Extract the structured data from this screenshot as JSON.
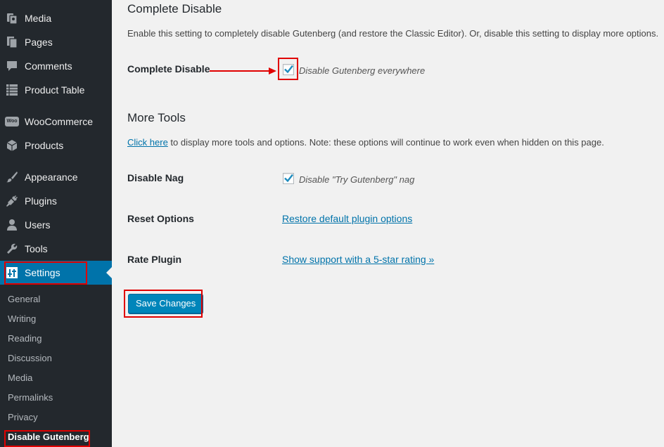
{
  "sidebar": {
    "items": [
      {
        "label": "Media",
        "icon": "media-icon"
      },
      {
        "label": "Pages",
        "icon": "pages-icon"
      },
      {
        "label": "Comments",
        "icon": "comments-icon"
      },
      {
        "label": "Product Table",
        "icon": "table-icon"
      },
      {
        "label": "WooCommerce",
        "icon": "woocommerce-icon"
      },
      {
        "label": "Products",
        "icon": "products-box-icon"
      },
      {
        "label": "Appearance",
        "icon": "appearance-brush-icon"
      },
      {
        "label": "Plugins",
        "icon": "plugins-icon"
      },
      {
        "label": "Users",
        "icon": "users-icon"
      },
      {
        "label": "Tools",
        "icon": "tools-wrench-icon"
      },
      {
        "label": "Settings",
        "icon": "settings-sliders-icon"
      }
    ],
    "submenu": [
      "General",
      "Writing",
      "Reading",
      "Discussion",
      "Media",
      "Permalinks",
      "Privacy",
      "Disable Gutenberg"
    ],
    "woo_icon_text": "Woo"
  },
  "main": {
    "complete_disable_heading": "Complete Disable",
    "complete_disable_desc": "Enable this setting to completely disable Gutenberg (and restore the Classic Editor). Or, disable this setting to display more options.",
    "complete_disable_label": "Complete Disable",
    "complete_disable_checkbox": "Disable Gutenberg everywhere",
    "more_tools_heading": "More Tools",
    "click_here": "Click here",
    "more_tools_desc": " to display more tools and options. Note: these options will continue to work even when hidden on this page.",
    "disable_nag_label": "Disable Nag",
    "disable_nag_checkbox": "Disable \"Try Gutenberg\" nag",
    "reset_options_label": "Reset Options",
    "reset_options_link": "Restore default plugin options",
    "rate_plugin_label": "Rate Plugin",
    "rate_plugin_link": "Show support with a 5-star rating »",
    "save_button": "Save Changes"
  },
  "colors": {
    "sidebar_bg": "#23282d",
    "active_bg": "#0073aa",
    "link": "#0073aa",
    "button": "#0085ba",
    "highlight": "#e00000"
  }
}
